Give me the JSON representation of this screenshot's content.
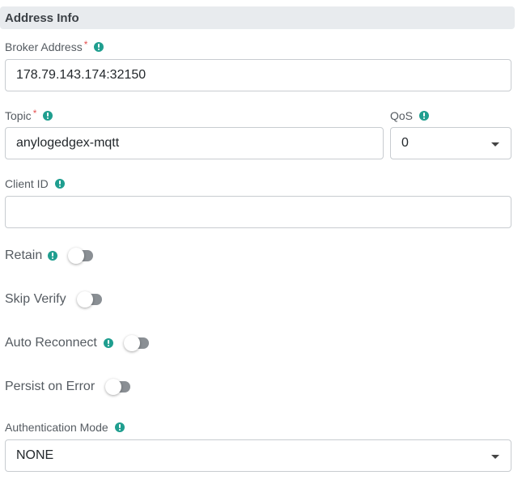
{
  "section": {
    "title": "Address Info"
  },
  "broker_address": {
    "label": "Broker Address",
    "required": "*",
    "value": "178.79.143.174:32150"
  },
  "topic": {
    "label": "Topic",
    "required": "*",
    "value": "anylogedgex-mqtt"
  },
  "qos": {
    "label": "QoS",
    "value": "0"
  },
  "client_id": {
    "label": "Client ID",
    "value": ""
  },
  "retain": {
    "label": "Retain",
    "enabled": false
  },
  "skip_verify": {
    "label": "Skip Verify",
    "enabled": false
  },
  "auto_reconnect": {
    "label": "Auto Reconnect",
    "enabled": false
  },
  "persist_on_error": {
    "label": "Persist on Error",
    "enabled": false
  },
  "auth_mode": {
    "label": "Authentication Mode",
    "value": "NONE"
  },
  "colors": {
    "info": "#1f9e8f",
    "required": "#e55353",
    "toggle_off": "#8a8f94",
    "header_bg": "#e8ebee"
  },
  "icons": {
    "info": "info-icon",
    "caret": "chevron-down-icon"
  }
}
